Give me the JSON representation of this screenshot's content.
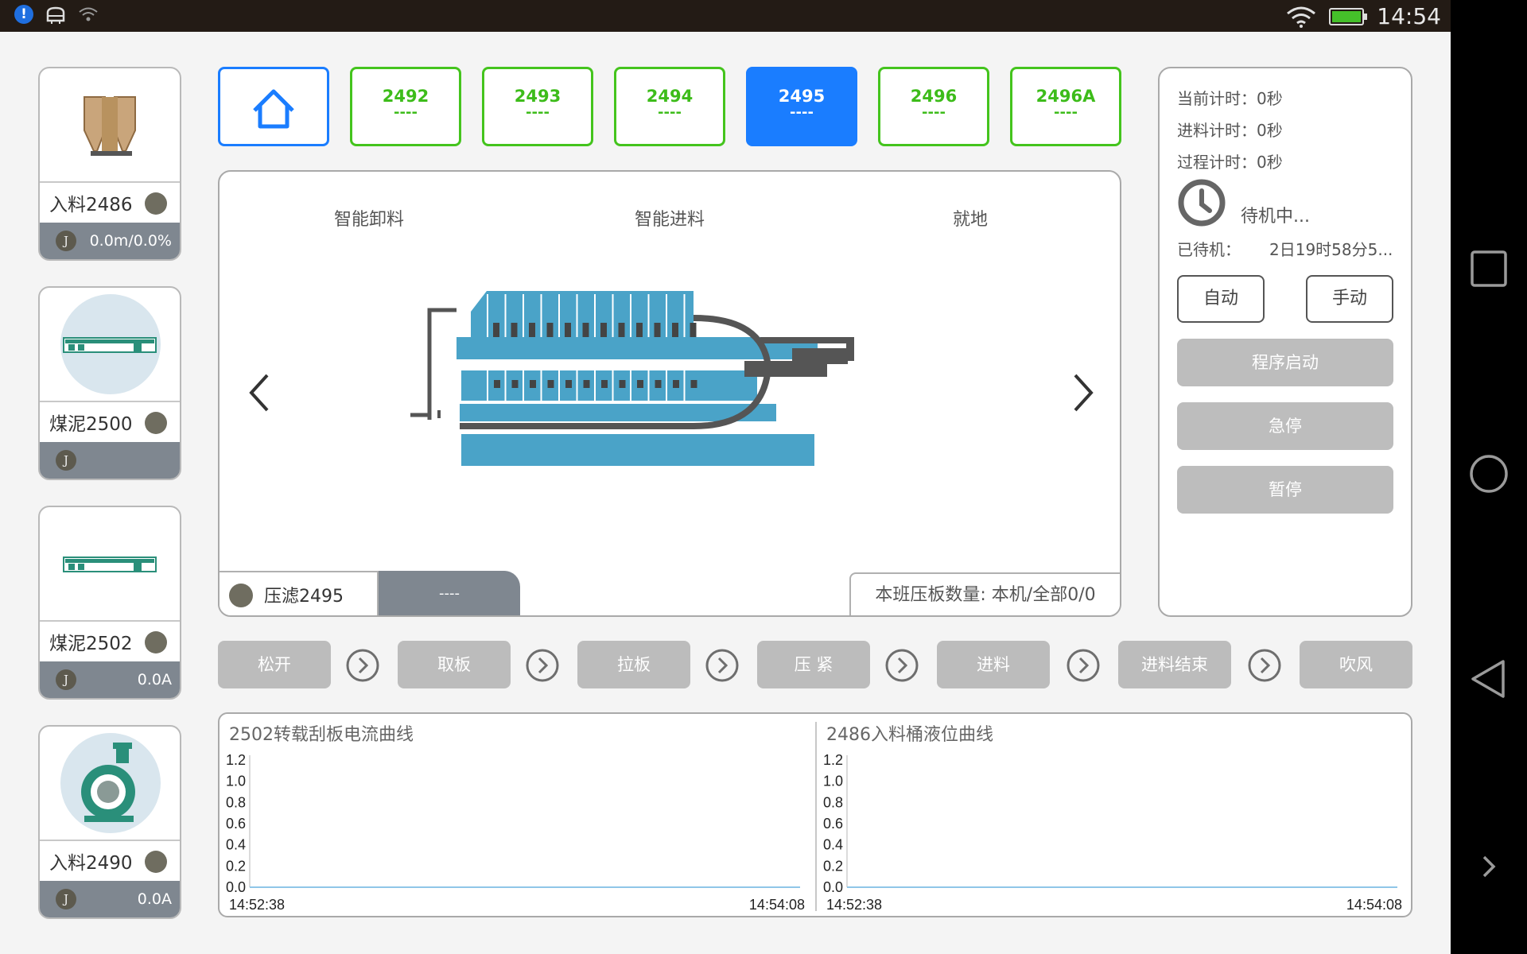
{
  "status_bar": {
    "time": "14:54"
  },
  "devices": [
    {
      "name": "入料2486",
      "j": "J",
      "value": "0.0m/0.0%"
    },
    {
      "name": "煤泥2500",
      "j": "J",
      "value": ""
    },
    {
      "name": "煤泥2502",
      "j": "J",
      "value": "0.0A"
    },
    {
      "name": "入料2490",
      "j": "J",
      "value": "0.0A"
    }
  ],
  "tabs": [
    {
      "num": "2492",
      "sub": "----"
    },
    {
      "num": "2493",
      "sub": "----"
    },
    {
      "num": "2494",
      "sub": "----"
    },
    {
      "num": "2495",
      "sub": "----"
    },
    {
      "num": "2496",
      "sub": "----"
    },
    {
      "num": "2496A",
      "sub": "----"
    }
  ],
  "main": {
    "modes": [
      "智能卸料",
      "智能进料",
      "就地"
    ],
    "machine_name": "压滤2495",
    "machine_status": "----",
    "plate_count": "本班压板数量: 本机/全部0/0"
  },
  "right": {
    "timers": [
      "当前计时：0秒",
      "进料计时：0秒",
      "过程计时：0秒"
    ],
    "state": "待机中...",
    "idle_label": "已待机：",
    "idle_value": "2日19时58分5...",
    "auto_label": "自动",
    "manual_label": "手动",
    "start_label": "程序启动",
    "estop_label": "急停",
    "pause_label": "暂停"
  },
  "steps": [
    "松开",
    "取板",
    "拉板",
    "压 紧",
    "进料",
    "进料结束",
    "吹风"
  ],
  "colors": {
    "accent": "#1a7dff",
    "tab_green": "#44c41d",
    "press_blue": "#4aa3c8"
  },
  "chart_data": [
    {
      "type": "line",
      "title": "2502转载刮板电流曲线",
      "x": [
        "14:52:38",
        "14:54:08"
      ],
      "series": [
        {
          "values": [
            0,
            0
          ]
        }
      ],
      "ylim": [
        0,
        1.2
      ],
      "yticks": [
        "1.2",
        "1.0",
        "0.8",
        "0.6",
        "0.4",
        "0.2",
        "0.0"
      ],
      "grid": false
    },
    {
      "type": "line",
      "title": "2486入料桶液位曲线",
      "x": [
        "14:52:38",
        "14:54:08"
      ],
      "series": [
        {
          "values": [
            0,
            0
          ]
        }
      ],
      "ylim": [
        0,
        1.2
      ],
      "yticks": [
        "1.2",
        "1.0",
        "0.8",
        "0.6",
        "0.4",
        "0.2",
        "0.0"
      ],
      "grid": false
    }
  ]
}
